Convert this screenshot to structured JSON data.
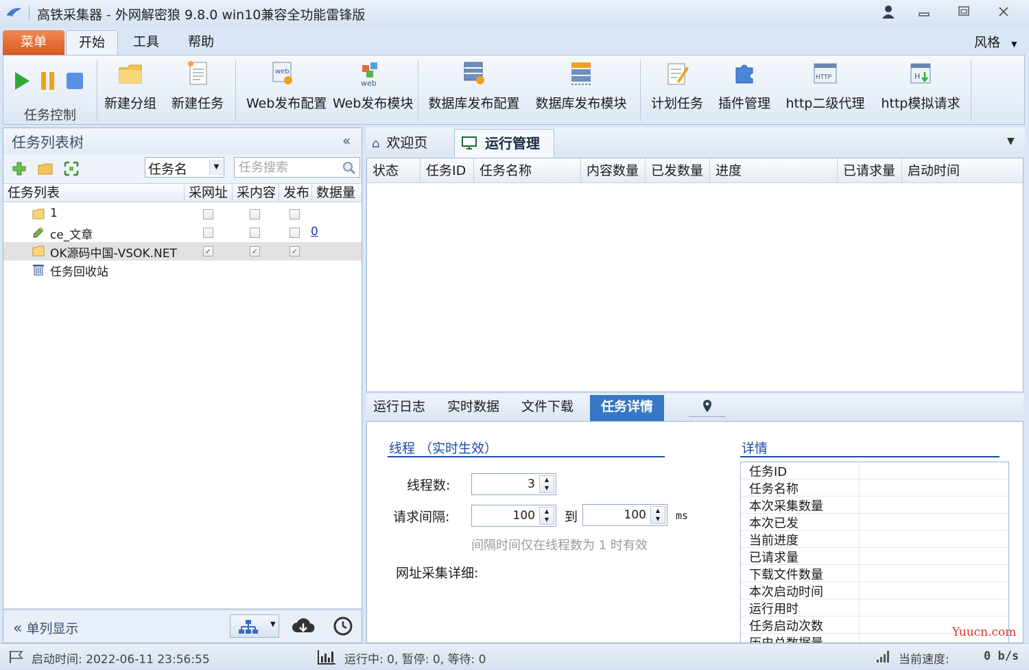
{
  "window": {
    "title": "高铁采集器 - 外网解密狼 9.8.0 win10兼容全功能雷锋版"
  },
  "ribbon_tabs": [
    "菜单",
    "开始",
    "工具",
    "帮助"
  ],
  "style_menu": "风格",
  "ribbon": {
    "task_control_label": "任务控制",
    "buttons": [
      "新建分组",
      "新建任务",
      "Web发布配置",
      "Web发布模块",
      "数据库发布配置",
      "数据库发布模块",
      "计划任务",
      "插件管理",
      "http二级代理",
      "http模拟请求"
    ]
  },
  "left_panel": {
    "title": "任务列表树",
    "filter_selected": "任务名",
    "search_placeholder": "任务搜索",
    "columns": [
      "任务列表",
      "采网址",
      "采内容",
      "发布",
      "数据量"
    ],
    "rows": [
      {
        "name": "1",
        "icon": "folder-icon",
        "c1": false,
        "c2": false,
        "c3": false,
        "count": ""
      },
      {
        "name": "ce_文章",
        "icon": "pencil-icon",
        "c1": false,
        "c2": false,
        "c3": false,
        "count": "0"
      },
      {
        "name": "OK源码中国-VSOK.NET",
        "icon": "folder-icon",
        "c1": true,
        "c2": true,
        "c3": true,
        "count": ""
      },
      {
        "name": "任务回收站",
        "icon": "trash-icon",
        "count": ""
      }
    ],
    "single_column_label": "单列显示"
  },
  "dock_tabs": [
    "欢迎页",
    "运行管理"
  ],
  "grid": {
    "columns": [
      "状态",
      "任务ID",
      "任务名称",
      "内容数量",
      "已发数量",
      "进度",
      "已请求量",
      "启动时间"
    ]
  },
  "bottom_tabs": [
    "运行日志",
    "实时数据",
    "文件下载",
    "任务详情"
  ],
  "detail": {
    "threads_section": "线程 （实时生效）",
    "threads_label": "线程数:",
    "threads_value": "3",
    "interval_label": "请求间隔:",
    "interval_from": "100",
    "interval_to_label": "到",
    "interval_to": "100",
    "interval_unit": "ms",
    "hint": "间隔时间仅在线程数为 1 时有效",
    "url_detail_label": "网址采集详细:",
    "info_section": "详情",
    "info_rows": [
      "任务ID",
      "任务名称",
      "本次采集数量",
      "本次已发",
      "当前进度",
      "已请求量",
      "下载文件数量",
      "本次启动时间",
      "运行用时",
      "任务启动次数",
      "历史总数据量"
    ]
  },
  "status_bar": {
    "start_time": "启动时间: 2022-06-11 23:56:55",
    "running": "运行中: 0, 暂停: 0, 等待: 0",
    "speed_label": "当前速度:",
    "speed_value": "0 b/s"
  },
  "watermark": "Yuucn.com",
  "colors": {
    "menu_tab": "#e0642b",
    "accent": "#3677c6",
    "section_title": "#1d4aa6",
    "link": "#1a36c9"
  }
}
